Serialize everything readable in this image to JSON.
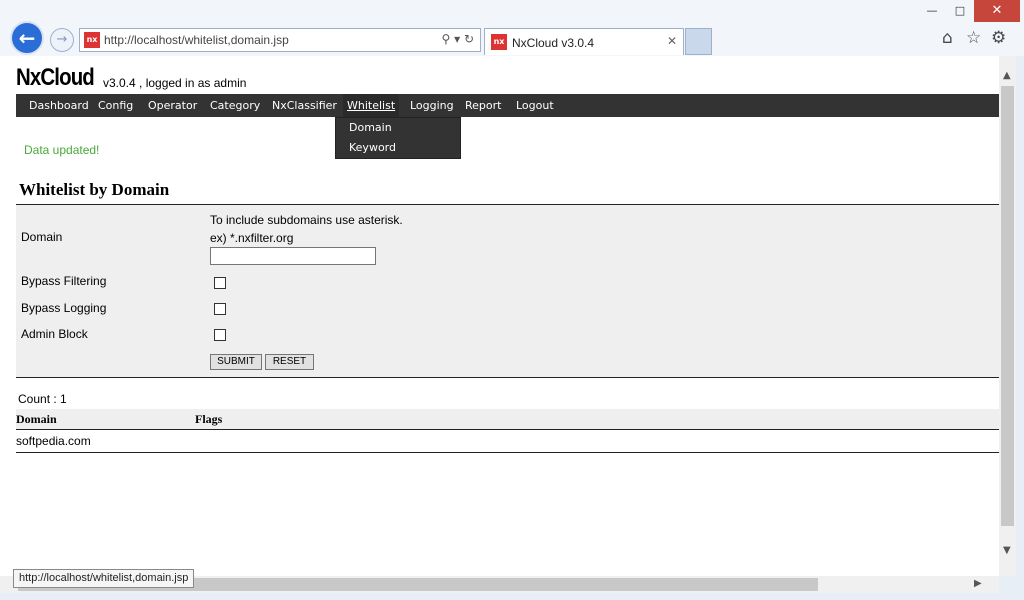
{
  "browser": {
    "url": "http://localhost/whitelist,domain.jsp",
    "tab_title": "NxCloud v3.0.4",
    "favicon_text": "nx",
    "icons": [
      "back-icon",
      "forward-icon",
      "search-icon",
      "refresh-icon",
      "home-icon",
      "favorites-star-icon",
      "settings-gear-icon"
    ]
  },
  "app": {
    "brand": "NxCloud",
    "subtitle": "v3.0.4 , logged in as admin"
  },
  "nav": {
    "items": [
      "Dashboard",
      "Config",
      "Operator",
      "Category",
      "NxClassifier",
      "Whitelist",
      "Logging",
      "Report",
      "Logout"
    ],
    "active": "Whitelist",
    "dropdown": [
      "Domain",
      "Keyword"
    ]
  },
  "message": "Data updated!",
  "page_title": "Whitelist by Domain",
  "form": {
    "domain_label": "Domain",
    "hint1": "To include subdomains use asterisk.",
    "hint2": "ex) *.nxfilter.org",
    "domain_value": "",
    "bypass_filtering_label": "Bypass Filtering",
    "bypass_logging_label": "Bypass Logging",
    "admin_block_label": "Admin Block",
    "bypass_filtering_checked": false,
    "bypass_logging_checked": false,
    "admin_block_checked": false,
    "submit_label": "SUBMIT",
    "reset_label": "RESET"
  },
  "list": {
    "count_text": "Count : 1",
    "columns": [
      "Domain",
      "Flags"
    ],
    "rows": [
      {
        "domain": "softpedia.com",
        "flags": ""
      }
    ]
  },
  "status_bar": "http://localhost/whitelist,domain.jsp",
  "colors": {
    "navbar": "#333333",
    "success": "#4aa83a",
    "close_button": "#c7463c",
    "back_button": "#2a6dd6"
  }
}
